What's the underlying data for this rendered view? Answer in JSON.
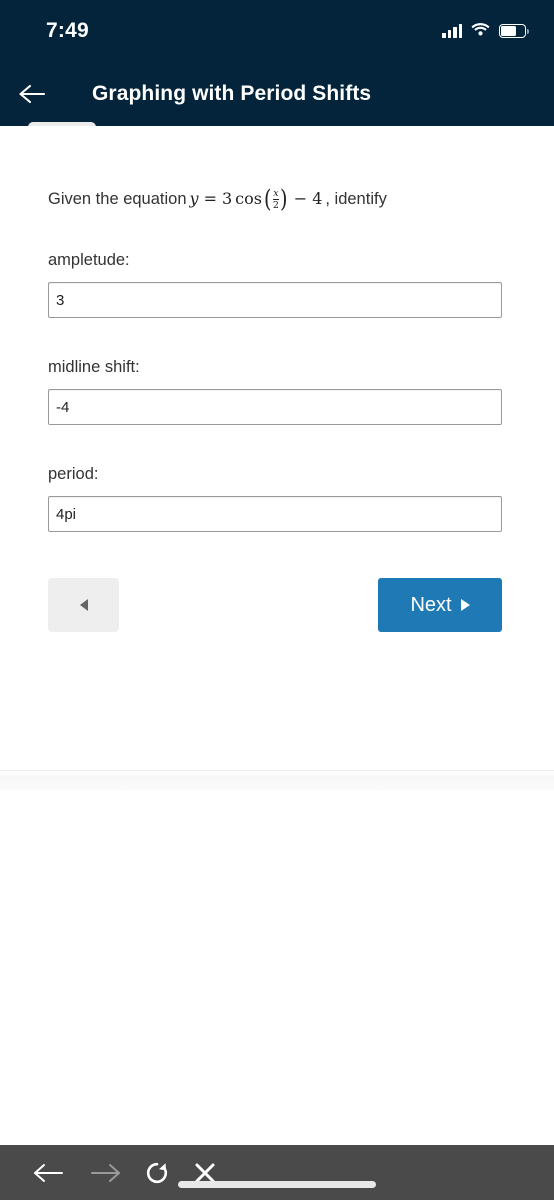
{
  "status_bar": {
    "time": "7:49",
    "icons": [
      "signal-bars-icon",
      "wifi-icon",
      "battery-icon"
    ],
    "battery_level_percent": 64,
    "background_color": "#04243c"
  },
  "header": {
    "back_icon": "back-arrow-icon",
    "title": "Graphing with Period Shifts",
    "background_color": "#04243c",
    "text_color": "#ffffff"
  },
  "content": {
    "prompt": {
      "lead_text": "Given the equation",
      "trail_text": ", identify",
      "equation": {
        "lhs": "y",
        "equals": "=",
        "coefficient": "3",
        "function": "cos",
        "open_paren": "(",
        "fraction_numerator": "x",
        "fraction_denominator": "2",
        "close_paren": ")",
        "minus": "−",
        "constant": "4",
        "plain": "y = 3 cos(x/2) − 4"
      }
    },
    "fields": [
      {
        "label": "ampletude:",
        "value": "3",
        "placeholder": ""
      },
      {
        "label": "midline shift:",
        "value": "-4",
        "placeholder": ""
      },
      {
        "label": "period:",
        "value": "4pi",
        "placeholder": ""
      }
    ],
    "buttons": {
      "prev_label": "",
      "prev_icon": "triangle-left-icon",
      "next_label": "Next",
      "next_icon": "triangle-right-icon",
      "next_color": "#1f79b5",
      "prev_color": "#eeeeee"
    }
  },
  "browser_bar": {
    "background_color": "#4a4a4a",
    "items": [
      {
        "icon": "arrow-left-icon",
        "state": "enabled"
      },
      {
        "icon": "arrow-right-icon",
        "state": "disabled"
      },
      {
        "icon": "reload-icon",
        "state": "enabled"
      },
      {
        "icon": "close-x-icon",
        "state": "enabled"
      }
    ]
  }
}
